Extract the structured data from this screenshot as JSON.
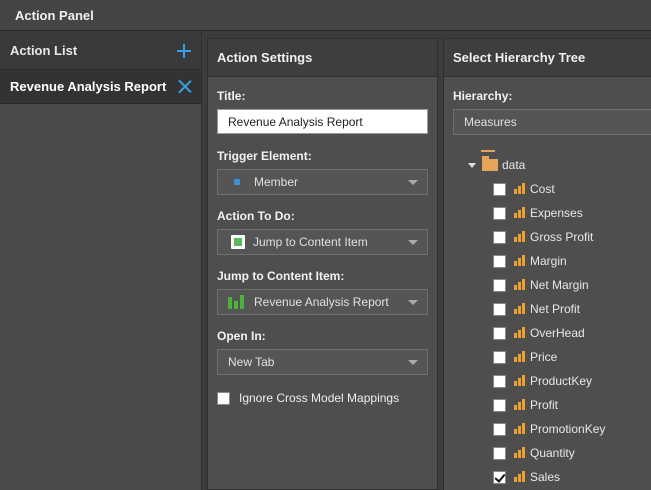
{
  "window": {
    "title": "Action Panel"
  },
  "action_list": {
    "header": "Action List",
    "items": [
      {
        "label": "Revenue Analysis Report"
      }
    ]
  },
  "settings": {
    "header": "Action Settings",
    "title_label": "Title:",
    "title_value": "Revenue Analysis Report",
    "trigger_label": "Trigger Element:",
    "trigger_value": "Member",
    "action_label": "Action To Do:",
    "action_value": "Jump to Content Item",
    "jump_label": "Jump to Content Item:",
    "jump_value": "Revenue Analysis Report",
    "open_label": "Open In:",
    "open_value": "New Tab",
    "ignore_label": "Ignore Cross Model Mappings",
    "ignore_checked": false
  },
  "hierarchy": {
    "header": "Select Hierarchy Tree",
    "label": "Hierarchy:",
    "value": "Measures",
    "root": "data",
    "measures": [
      {
        "label": "Cost",
        "checked": false
      },
      {
        "label": "Expenses",
        "checked": false
      },
      {
        "label": "Gross Profit",
        "checked": false
      },
      {
        "label": "Margin",
        "checked": false
      },
      {
        "label": "Net Margin",
        "checked": false
      },
      {
        "label": "Net Profit",
        "checked": false
      },
      {
        "label": "OverHead",
        "checked": false
      },
      {
        "label": "Price",
        "checked": false
      },
      {
        "label": "ProductKey",
        "checked": false
      },
      {
        "label": "Profit",
        "checked": false
      },
      {
        "label": "PromotionKey",
        "checked": false
      },
      {
        "label": "Quantity",
        "checked": false
      },
      {
        "label": "Sales",
        "checked": true
      }
    ]
  },
  "colors": {
    "accent": "#3aa0e6",
    "measure_icon": "#f0a030",
    "folder": "#e6a35a"
  }
}
